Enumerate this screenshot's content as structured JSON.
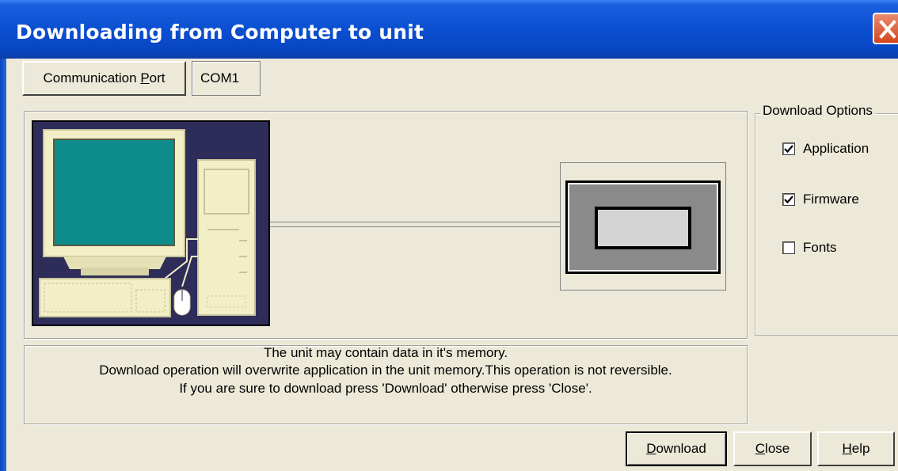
{
  "window": {
    "title": "Downloading from Computer to unit"
  },
  "port": {
    "button_label_pre": "Communication ",
    "button_label_key": "P",
    "button_label_post": "ort",
    "value": "COM1"
  },
  "illustration": {
    "computer": "computer-with-keyboard-and-mouse",
    "unit": "operator-panel-unit"
  },
  "message": {
    "line1": "The unit may contain data in it's memory.",
    "line2": "Download operation will overwrite application in the unit memory.This operation is not reversible.",
    "line3": "If you are sure to download press 'Download' otherwise press 'Close'."
  },
  "options": {
    "legend": "Download Options",
    "items": [
      {
        "label": "Application",
        "checked": true
      },
      {
        "label": "Firmware",
        "checked": true
      },
      {
        "label": "Fonts",
        "checked": false
      }
    ]
  },
  "buttons": {
    "download_key": "D",
    "download_rest": "ownload",
    "close_key": "C",
    "close_rest": "lose",
    "help_key": "H",
    "help_rest": "elp"
  },
  "colors": {
    "titlebar": "#0a4fd0",
    "dialog_bg": "#ece9d8",
    "illustration_bg": "#2e2d5a",
    "monitor_screen": "#0e8c8c",
    "computer_body": "#f2eec6"
  }
}
